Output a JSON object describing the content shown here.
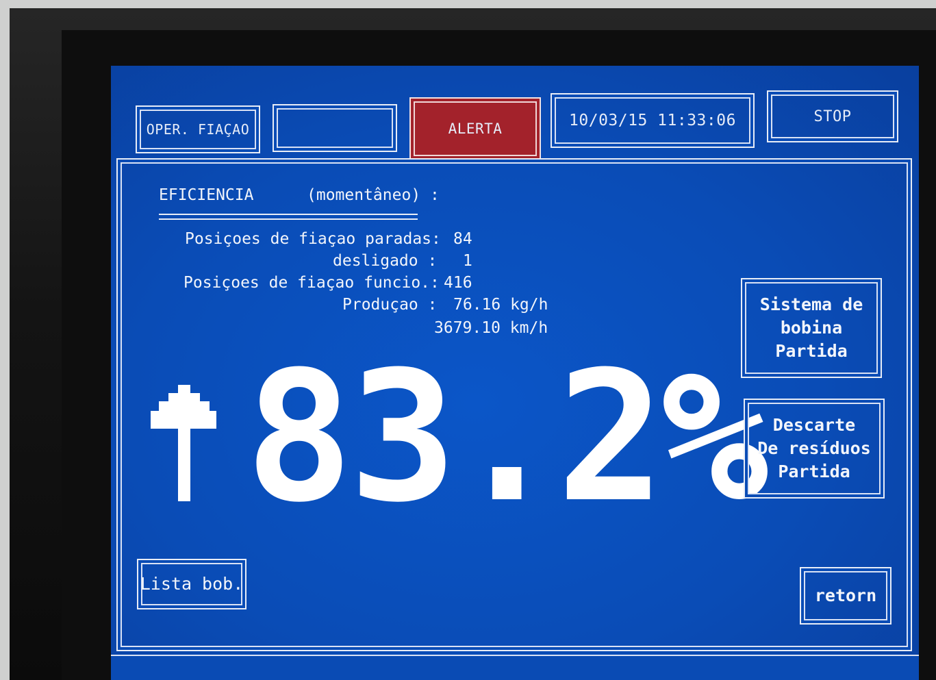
{
  "colors": {
    "screen_background": "#0a4cb6",
    "alert_red": "#a3222b",
    "text": "#f2f5fb"
  },
  "header": {
    "mode_label": "OPER. FIAÇAO",
    "blank_label": "",
    "alert_label": "ALERTA",
    "datetime": "10/03/15 11:33:06",
    "stop_label": "STOP"
  },
  "panel": {
    "title": "EFICIENCIA",
    "title_note": "(momentâneo) :",
    "stats": {
      "stopped_label": "Posiçoes de fiaçao paradas:",
      "stopped_value": "84",
      "off_label": "desligado :",
      "off_value": "1",
      "running_label": "Posiçoes de fiaçao funcio.:",
      "running_value": "416",
      "production_label": "Produçao :",
      "production_kg": "76.16 kg/h",
      "production_km": "3679.10 km/h"
    },
    "efficiency_value": "83.2%",
    "trend_icon": "up-arrow-icon"
  },
  "buttons": {
    "bobbin_system": "Sistema de\nbobina\nPartida",
    "waste_discard": "Descarte\nDe resíduos\nPartida",
    "bobbin_list": "Lista bob.",
    "return": "retorn"
  }
}
